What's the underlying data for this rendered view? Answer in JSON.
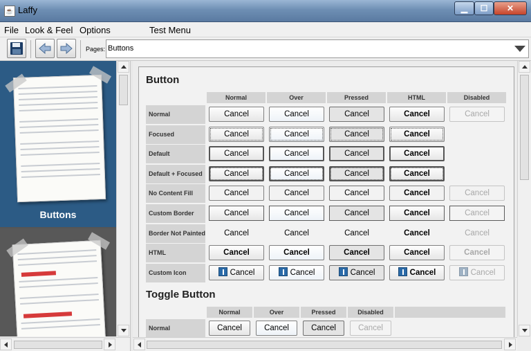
{
  "window": {
    "title": "Laffy",
    "icon": "java-cup-icon"
  },
  "menubar": [
    "File",
    "Look & Feel",
    "Options",
    "Test Menu"
  ],
  "toolbar": {
    "save_icon": "floppy-disk-icon",
    "back_icon": "arrow-left-icon",
    "forward_icon": "arrow-right-icon",
    "pages_label": "Pages:",
    "pages_value": "Buttons"
  },
  "sidebar": {
    "thumbnails": [
      {
        "caption": "Buttons"
      },
      {
        "caption": ""
      }
    ]
  },
  "button_section": {
    "title": "Button",
    "columns": [
      "Normal",
      "Over",
      "Pressed",
      "HTML",
      "Disabled"
    ],
    "rows": [
      {
        "label": "Normal"
      },
      {
        "label": "Focused"
      },
      {
        "label": "Default"
      },
      {
        "label": "Default + Focused"
      },
      {
        "label": "No Content Fill"
      },
      {
        "label": "Custom Border"
      },
      {
        "label": "Border Not Painted"
      },
      {
        "label": "HTML"
      },
      {
        "label": "Custom Icon"
      }
    ],
    "button_text": "Cancel"
  },
  "toggle_section": {
    "title": "Toggle Button",
    "columns": [
      "Normal",
      "Over",
      "Pressed",
      "Disabled"
    ],
    "rows": [
      {
        "label": "Normal"
      }
    ],
    "button_text": "Cancel"
  },
  "colors": {
    "thumbnail_bg": "#2c5b85",
    "accent_red": "#d63a3a",
    "close_button": "#c6442a"
  }
}
